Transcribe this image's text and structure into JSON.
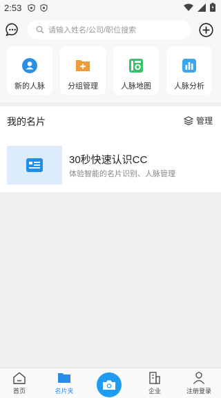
{
  "status_bar": {
    "time": "2:53"
  },
  "header": {
    "search_placeholder": "请输入姓名/公司/职位搜索"
  },
  "quick_actions": [
    {
      "label": "新的人脉",
      "icon": "new-contact-icon"
    },
    {
      "label": "分组管理",
      "icon": "folder-add-icon"
    },
    {
      "label": "人脉地图",
      "icon": "map-icon"
    },
    {
      "label": "人脉分析",
      "icon": "chart-icon"
    }
  ],
  "cards_section": {
    "title": "我的名片",
    "manage_label": "管理",
    "promo": {
      "title": "30秒快速认识CC",
      "subtitle": "体验智能的名片识别、人脉管理"
    }
  },
  "bottom_nav": {
    "items": [
      {
        "label": "首页",
        "icon": "home-icon",
        "active": false
      },
      {
        "label": "名片夹",
        "icon": "folder-icon",
        "active": true
      },
      {
        "label": "企业",
        "icon": "building-icon",
        "active": false
      },
      {
        "label": "注册登录",
        "icon": "person-icon",
        "active": false
      }
    ]
  },
  "colors": {
    "accent": "#2a8ce8",
    "orange": "#f39a3a",
    "green": "#36c36a",
    "camera": "#1f9cf0"
  }
}
